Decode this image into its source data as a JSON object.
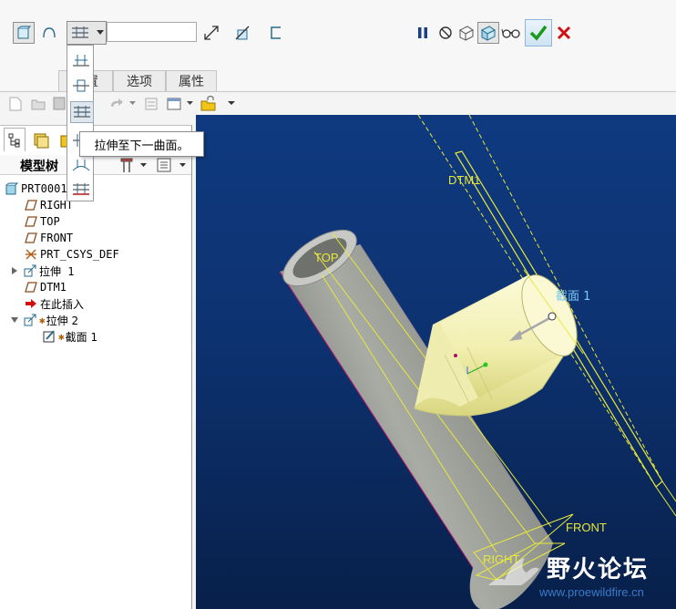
{
  "dashboard": {
    "depth_value": "",
    "tabs": [
      {
        "label": "放置"
      },
      {
        "label": "选项"
      },
      {
        "label": "属性"
      }
    ],
    "icons": {
      "solid": "solid-icon",
      "surface": "surface-icon",
      "depth_option": "extrude-to-next-icon",
      "flip": "flip-direction-icon",
      "remove_material": "remove-material-icon",
      "thicken": "thicken-icon",
      "pause": "pause-icon",
      "no_preview": "no-preview-icon",
      "preview": "preview-icon",
      "verify": "verify-icon",
      "glasses": "glasses-icon",
      "ok": "checkmark-icon",
      "cancel": "close-icon"
    }
  },
  "dropdown_items": [
    "blind-depth-icon",
    "symmetric-icon",
    "to-next-icon",
    "through-all-icon",
    "through-until-icon",
    "to-selected-icon"
  ],
  "tooltip": "拉伸至下一曲面。",
  "tree": {
    "header_label": "模型树",
    "root": "PRT0001.PRT",
    "items": [
      {
        "label": "RIGHT",
        "icon": "datum-plane-icon"
      },
      {
        "label": "TOP",
        "icon": "datum-plane-icon"
      },
      {
        "label": "FRONT",
        "icon": "datum-plane-icon"
      },
      {
        "label": "PRT_CSYS_DEF",
        "icon": "csys-icon"
      },
      {
        "label": "拉伸 1",
        "icon": "extrude-icon"
      },
      {
        "label": "DTM1",
        "icon": "datum-plane-icon"
      },
      {
        "label": "在此插入",
        "icon": "insert-arrow-icon"
      },
      {
        "label": "拉伸 2",
        "icon": "extrude-icon"
      },
      {
        "label": "截面 1",
        "icon": "sketch-icon"
      }
    ]
  },
  "viewport": {
    "labels": {
      "dtm1": "DTM1",
      "top": "TOP",
      "section": "截面 1",
      "front": "FRONT",
      "right": "RIGHT"
    }
  },
  "watermark": {
    "title": "野火论坛",
    "url": "www.proewildfire.cn"
  },
  "colors": {
    "accent_green": "#1a9a1a",
    "cancel_red": "#d01010",
    "datum_yellow": "#e8e83a",
    "cylinder_gray": "#8a8d86",
    "cone_yellow": "#f6f4be"
  }
}
